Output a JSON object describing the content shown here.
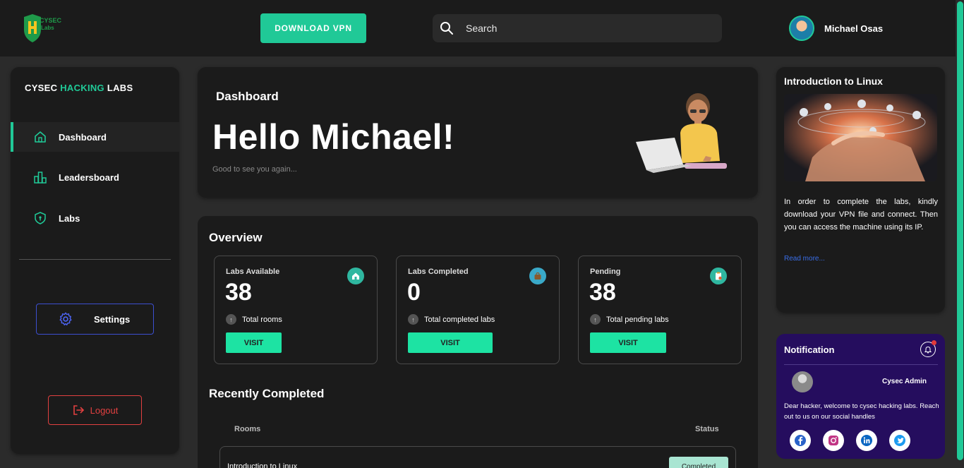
{
  "topbar": {
    "logo_text": "CYSEC Labs",
    "download_label": "DOWNLOAD VPN",
    "search_placeholder": "Search",
    "user_name": "Michael Osas"
  },
  "sidebar": {
    "brand_prefix": "CYSEC ",
    "brand_accent": "HACKING",
    "brand_suffix": " LABS",
    "items": [
      {
        "label": "Dashboard",
        "icon": "home-icon",
        "active": true
      },
      {
        "label": "Leadersboard",
        "icon": "bar-chart-icon",
        "active": false
      },
      {
        "label": "Labs",
        "icon": "shield-icon",
        "active": false
      }
    ],
    "settings_label": "Settings",
    "logout_label": "Logout"
  },
  "hero": {
    "title": "Dashboard",
    "greeting": "Hello Michael!",
    "subtitle": "Good to see you again..."
  },
  "overview": {
    "title": "Overview",
    "stats": [
      {
        "label": "Labs Available",
        "value": "38",
        "caption": "Total rooms",
        "button": "VISIT",
        "icon": "home-badge-icon"
      },
      {
        "label": "Labs Completed",
        "value": "0",
        "caption": "Total completed labs",
        "button": "VISIT",
        "icon": "bag-badge-icon"
      },
      {
        "label": "Pending",
        "value": "38",
        "caption": "Total pending labs",
        "button": "VISIT",
        "icon": "clipboard-badge-icon"
      }
    ],
    "up_arrow": "↑"
  },
  "recent": {
    "title": "Recently Completed",
    "col_rooms": "Rooms",
    "col_status": "Status",
    "rows": [
      {
        "room": "Introduction to Linux",
        "status": "Completed"
      }
    ]
  },
  "intro": {
    "title": "Introduction to Linux",
    "description": "In order to complete the labs, kindly download your VPN file and connect. Then you can access the machine using its IP.",
    "read_more": "Read more..."
  },
  "notification": {
    "title": "Notification",
    "sender": "Cysec Admin",
    "message": "Dear hacker, welcome to cysec hacking labs. Reach out to us on our social handles",
    "socials": [
      "facebook-icon",
      "instagram-icon",
      "linkedin-icon",
      "twitter-icon"
    ]
  },
  "colors": {
    "accent": "#20c997",
    "visit": "#1de3a3",
    "danger": "#e24040",
    "settings_border": "#3c4fd1",
    "notification_bg": "#250d5e",
    "link": "#3a6ee8"
  }
}
